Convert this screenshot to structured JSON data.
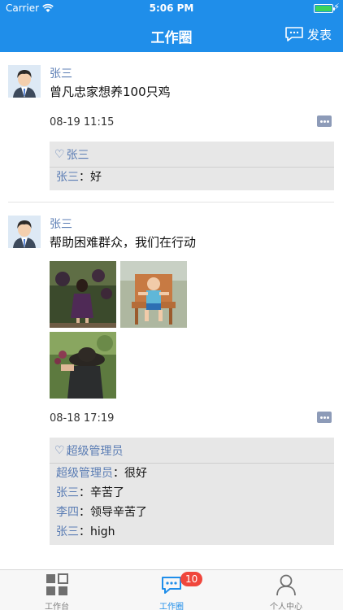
{
  "status_bar": {
    "carrier": "Carrier",
    "time": "5:06 PM",
    "battery_level": 1.0
  },
  "nav": {
    "title": "工作圈",
    "post_label": "发表",
    "post_icon": "chat-bubble-icon"
  },
  "colors": {
    "primary": "#1F8EEA",
    "name_link": "#5b7db4",
    "comment_bg": "#e7e7e7",
    "badge": "#f0463c"
  },
  "posts": [
    {
      "author": "张三",
      "content": "曾凡忠家想养100只鸡",
      "time": "08-19 11:15",
      "likes": "张三",
      "comments": [
        {
          "name": "张三",
          "sep": "：",
          "text": "好"
        }
      ]
    },
    {
      "author": "张三",
      "content": "帮助困难群众，我们在行动",
      "time": "08-18 17:19",
      "photos": [
        "photo-grapes-vineyard",
        "photo-child-on-chair",
        "photo-person-in-vines"
      ],
      "likes": "超级管理员",
      "comments": [
        {
          "name": "超级管理员",
          "sep": "：",
          "text": "很好"
        },
        {
          "name": "张三",
          "sep": "：",
          "text": "辛苦了"
        },
        {
          "name": "李四",
          "sep": "：",
          "text": "领导辛苦了"
        },
        {
          "name": "张三",
          "sep": "：",
          "text": "high"
        }
      ]
    }
  ],
  "tabbar": {
    "tabs": [
      {
        "label": "工作台",
        "icon": "grid-icon"
      },
      {
        "label": "工作圈",
        "icon": "chat-bubble-icon",
        "badge": "10",
        "active": true
      },
      {
        "label": "个人中心",
        "icon": "person-icon"
      }
    ]
  }
}
